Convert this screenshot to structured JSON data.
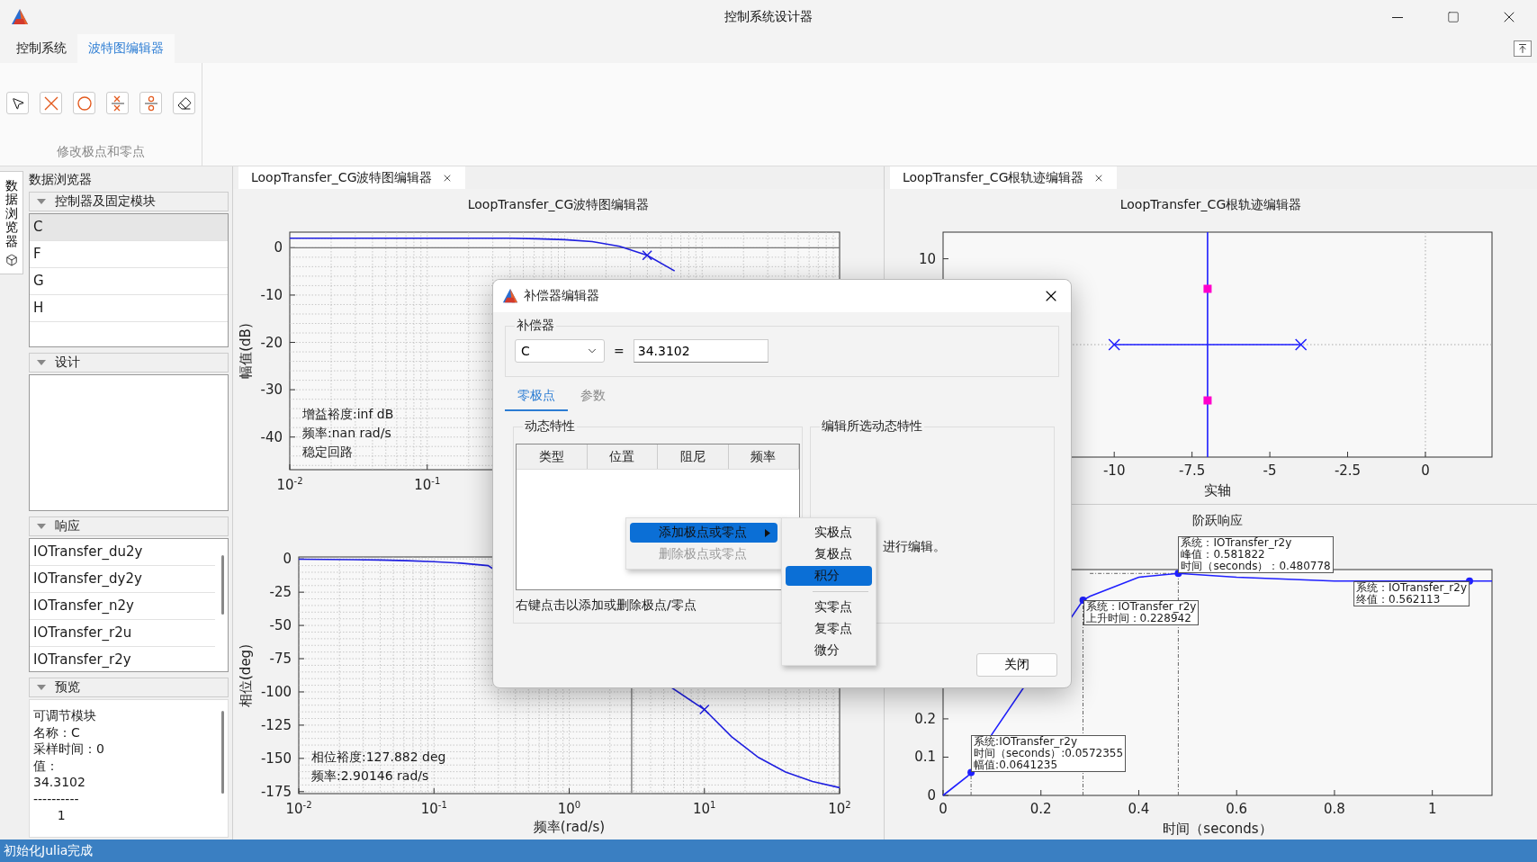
{
  "window": {
    "title": "控制系统设计器"
  },
  "ribbon": {
    "tabs": [
      {
        "label": "控制系统",
        "selected": false
      },
      {
        "label": "波特图编辑器",
        "selected": true
      }
    ],
    "tools": [
      {
        "kind": "select"
      },
      {
        "kind": "pole"
      },
      {
        "kind": "zero"
      },
      {
        "kind": "pole-pair"
      },
      {
        "kind": "zero-pair"
      },
      {
        "kind": "erase"
      }
    ],
    "group_label": "修改极点和零点"
  },
  "sidebar": {
    "tab": "数据浏览器",
    "title": "数据浏览器",
    "sections": [
      {
        "title": "控制器及固定模块",
        "expanded": true,
        "kind": "list",
        "items": [
          {
            "label": "C",
            "selected": true
          },
          {
            "label": "F",
            "selected": false
          },
          {
            "label": "G",
            "selected": false
          },
          {
            "label": "H",
            "selected": false
          }
        ]
      },
      {
        "title": "设计",
        "expanded": true,
        "kind": "empty"
      },
      {
        "title": "响应",
        "expanded": true,
        "kind": "scroll-list",
        "items": [
          {
            "label": "IOTransfer_du2y",
            "selected": false
          },
          {
            "label": "IOTransfer_dy2y",
            "selected": false
          },
          {
            "label": "IOTransfer_n2y",
            "selected": false
          },
          {
            "label": "IOTransfer_r2u",
            "selected": false
          },
          {
            "label": "IOTransfer_r2y",
            "selected": false
          }
        ]
      },
      {
        "title": "预览",
        "expanded": true,
        "kind": "text",
        "lines": [
          "可调节模块",
          "名称：C",
          "采样时间：0",
          "值：",
          "34.3102",
          "----------",
          "      1"
        ]
      }
    ]
  },
  "bode_editor": {
    "tab": "LoopTransfer_CG波特图编辑器",
    "title": "LoopTransfer_CG波特图编辑器",
    "magnitude_plot": {
      "info": [
        "增益裕度:inf dB",
        "频率:nan rad/s",
        "稳定回路"
      ],
      "chart_data": {
        "type": "line",
        "ylabel": "幅值(dB)",
        "grid": true,
        "categories": [
          "10$^{-2}$",
          null,
          null,
          null,
          null,
          "10$^{-1}$",
          null,
          null,
          null,
          null,
          null,
          null,
          null,
          null,
          null,
          null,
          null,
          null,
          null,
          null,
          null
        ],
        "series": [
          {
            "color": "#1f1fe0",
            "values": [
              2.0,
              2.0,
              2.0,
              2.0,
              2.0,
              2.0,
              2.0,
              2.0,
              2.0,
              1.9,
              1.7,
              1.3,
              0.3,
              -1.6,
              -4.9,
              null,
              null,
              null,
              null,
              null,
              null
            ]
          },
          {
            "color": "#1f1fe0",
            "marker": "cross",
            "line_style": "none",
            "values": [
              null,
              null,
              null,
              null,
              null,
              null,
              null,
              null,
              null,
              null,
              null,
              null,
              null,
              -1.6,
              null,
              null,
              null,
              null,
              null,
              null,
              null
            ]
          }
        ],
        "ylim": [
          -46.9,
          3.3
        ],
        "yticks": [
          {
            "value": 0,
            "label": "0"
          },
          {
            "value": -10,
            "label": "-10"
          },
          {
            "value": -20,
            "label": "-20"
          },
          {
            "value": -30,
            "label": "-30"
          },
          {
            "value": -40,
            "label": "-40"
          }
        ],
        "ref_lines": [
          {
            "axis": "y",
            "value": 0
          }
        ]
      }
    },
    "phase_plot": {
      "info": [
        "相位裕度:127.882 deg",
        "频率:2.90146 rad/s"
      ],
      "chart_data": {
        "type": "line",
        "ylabel": "相位(deg)",
        "xlabel": "频率(rad/s)",
        "grid": true,
        "categories": [
          "10$^{-2}$",
          null,
          null,
          null,
          null,
          "10$^{-1}$",
          null,
          null,
          null,
          null,
          "10$^{0}$",
          null,
          null,
          null,
          null,
          "10$^{1}$",
          null,
          null,
          null,
          null,
          "10$^{2}$"
        ],
        "series": [
          {
            "color": "#1f1fe0",
            "values": [
              -0.2,
              -0.3,
              -0.5,
              -0.8,
              -1.3,
              -2.0,
              -3.2,
              -5.0,
              null,
              null,
              null,
              null,
              null,
              null,
              null,
              -113.2,
              -133.6,
              -149.3,
              -160.2,
              -167.4,
              -172.0
            ]
          },
          {
            "color": "#1f1fe0",
            "marker": "cross",
            "line_style": "none",
            "values": [
              null,
              null,
              null,
              null,
              null,
              null,
              null,
              null,
              null,
              null,
              null,
              null,
              null,
              null,
              null,
              -113.2,
              null,
              null,
              null,
              null,
              null
            ]
          }
        ],
        "ylim": [
          -176.5,
          1.5
        ],
        "yticks": [
          {
            "value": 0,
            "label": "0"
          },
          {
            "value": -25,
            "label": "-25"
          },
          {
            "value": -50,
            "label": "-50"
          },
          {
            "value": -75,
            "label": "-75"
          },
          {
            "value": -100,
            "label": "-100"
          },
          {
            "value": -125,
            "label": "-125"
          },
          {
            "value": -150,
            "label": "-150"
          },
          {
            "value": -175,
            "label": "-175"
          }
        ]
      }
    }
  },
  "root_locus_editor": {
    "tab": "LoopTransfer_CG根轨迹编辑器",
    "title": "LoopTransfer_CG根轨迹编辑器",
    "locus_plot": {
      "xticks": [
        "-10",
        "-7.5",
        "-5",
        "-2.5",
        "0"
      ],
      "yticks": [
        "10"
      ],
      "xlabel": "实轴"
    },
    "step_plot": {
      "chart_data": {
        "type": "line",
        "title": "阶跃响应",
        "xlabel": "时间（seconds）",
        "x": [
          0,
          0.05,
          0.0572,
          0.1,
          0.2861,
          0.3,
          0.4,
          0.4808,
          0.6,
          0.8,
          1.076,
          1.122
        ],
        "series": [
          {
            "color": "#666666",
            "line_style": "dashed",
            "x": [
              0.0572,
              0.0572
            ],
            "values": [
              0,
              0.06
            ]
          },
          {
            "color": "#666666",
            "line_style": "dashed",
            "x": [
              0.2861,
              0.2861
            ],
            "values": [
              0,
              0.51
            ]
          },
          {
            "color": "#666666",
            "line_style": "dashed",
            "x": [
              0.4808,
              0.4808
            ],
            "values": [
              0,
              0.58
            ]
          },
          {
            "color": "#666666",
            "line_style": "dashed",
            "x": [
              0.3,
              0.4808
            ],
            "values": [
              0.58,
              0.58
            ]
          },
          {
            "color": "#1f1fff",
            "values": [
              0,
              0.05,
              0.06,
              0.16,
              0.51,
              0.52,
              0.57,
              0.58,
              0.57,
              0.56,
              0.56,
              0.56
            ]
          }
        ],
        "xlim": [
          0,
          1.122
        ],
        "ylim": [
          0,
          0.59
        ],
        "xticks": [
          {
            "value": 0,
            "label": "0"
          },
          {
            "value": 0.2,
            "label": "0.2"
          },
          {
            "value": 0.4,
            "label": "0.4"
          },
          {
            "value": 0.6,
            "label": "0.6"
          },
          {
            "value": 0.8,
            "label": "0.8"
          },
          {
            "value": 1,
            "label": "1"
          }
        ],
        "yticks": [
          {
            "value": 0,
            "label": "0"
          },
          {
            "value": 0.1,
            "label": "0.1"
          },
          {
            "value": 0.2,
            "label": "0.2"
          }
        ],
        "annotations": [
          {
            "x": 0.0572,
            "y": 0.06,
            "text": "系统:IOTransfer_r2y"
          },
          {
            "x": 0.0572,
            "y": 0.06,
            "text": "时间（seconds）:0.0572355"
          },
          {
            "x": 0.0572,
            "y": 0.06,
            "text": "幅值:0.0641235"
          },
          {
            "x": 0.2861,
            "y": 0.51,
            "text": "系统：IOTransfer_r2y"
          },
          {
            "x": 0.2861,
            "y": 0.51,
            "text": "上升时间：0.228942"
          },
          {
            "x": 0.4808,
            "y": 0.58,
            "text": "系统：IOTransfer_r2y"
          },
          {
            "x": 0.4808,
            "y": 0.58,
            "text": "峰值：0.581822"
          },
          {
            "x": 0.4808,
            "y": 0.58,
            "text": "时间（seconds）：0.480778"
          },
          {
            "x": 1.076,
            "y": 0.56,
            "text": "系统：IOTransfer_r2y"
          },
          {
            "x": 1.076,
            "y": 0.56,
            "text": "终值：0.562113"
          }
        ]
      }
    }
  },
  "dialog": {
    "title": "补偿器编辑器",
    "compensator": {
      "label": "补偿器",
      "name": "C",
      "equals": "=",
      "value": "34.3102"
    },
    "tabs": [
      {
        "label": "零极点",
        "selected": true
      },
      {
        "label": "参数",
        "selected": false
      }
    ],
    "dynamics": {
      "title": "动态特性",
      "columns": [
        "类型",
        "位置",
        "阻尼",
        "频率"
      ],
      "hint": "右键点击以添加或删除极点/零点"
    },
    "edit_panel": {
      "title": "编辑所选动态特性",
      "text": "进行编辑。"
    },
    "close_button": "关闭"
  },
  "context_menu": {
    "items": [
      {
        "label": "添加极点或零点",
        "selected": true,
        "disabled": false,
        "has_submenu": true
      },
      {
        "label": "删除极点或零点",
        "selected": false,
        "disabled": true,
        "has_submenu": false
      }
    ]
  },
  "submenu": {
    "items": [
      {
        "kind": "item",
        "label": "实极点",
        "selected": false
      },
      {
        "kind": "item",
        "label": "复极点",
        "selected": false
      },
      {
        "kind": "item",
        "label": "积分",
        "selected": true
      },
      {
        "kind": "separator"
      },
      {
        "kind": "item",
        "label": "实零点",
        "selected": false
      },
      {
        "kind": "item",
        "label": "复零点",
        "selected": false
      },
      {
        "kind": "item",
        "label": "微分",
        "selected": false
      }
    ]
  },
  "status_bar": {
    "text": "初始化Julia完成"
  }
}
